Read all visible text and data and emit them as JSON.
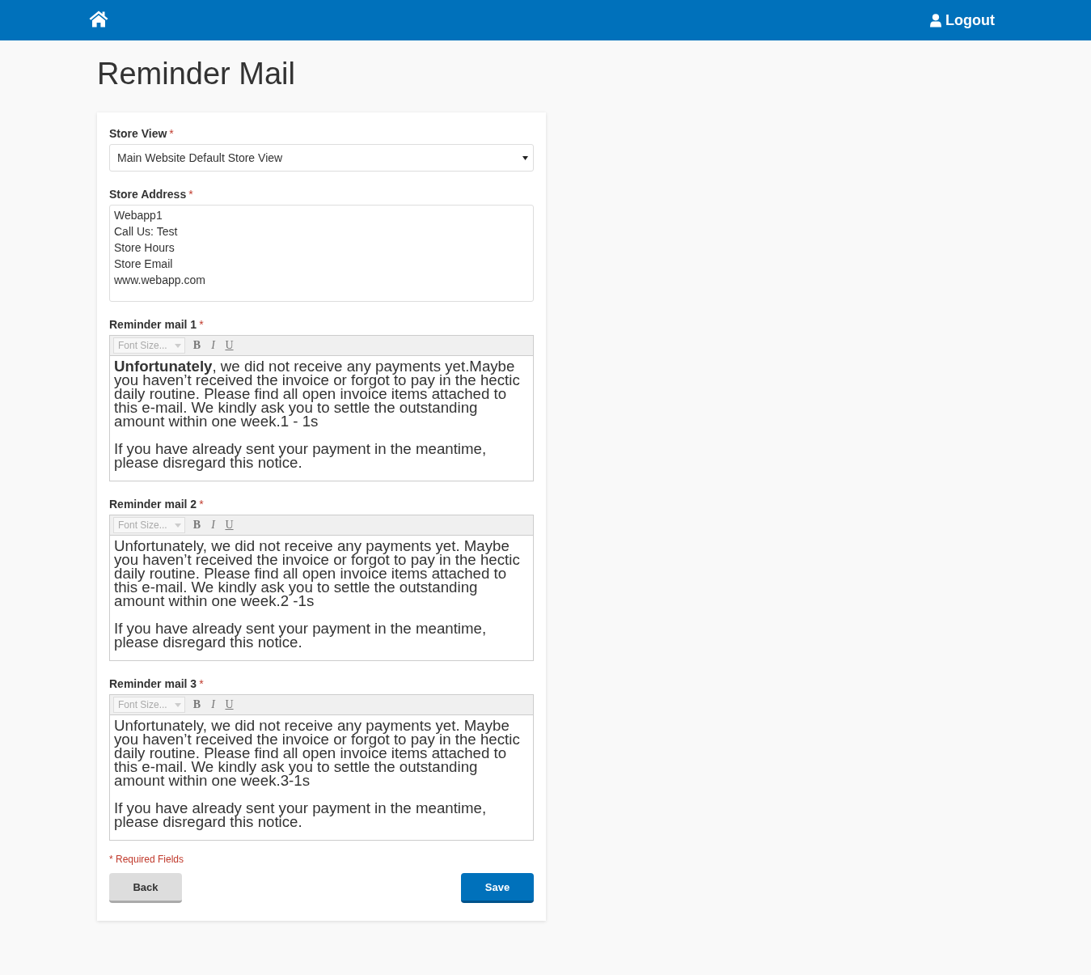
{
  "header": {
    "logout": "Logout"
  },
  "title": "Reminder Mail",
  "form": {
    "fields": [
      {
        "kind": "select",
        "label": "Store View",
        "mark": "*",
        "value": "Main Website Default Store View"
      },
      {
        "kind": "textarea",
        "label": "Store Address",
        "mark": "*",
        "lines": [
          "Webapp1",
          "Call Us: Test",
          "Store Hours",
          "Store Email",
          "www.webapp.com"
        ]
      },
      {
        "kind": "editor",
        "label": "Reminder mail 1",
        "mark": "*",
        "toolbar": {
          "font_size": "Font Size...",
          "bold": "B",
          "italic": "I",
          "underline": "U"
        },
        "paragraphs": [
          "**Unfortunately**, we did not receive any payments yet.Maybe you haven’t received the invoice or forgot to pay in the hectic daily routine. Please find all open invoice items attached to this e-mail. We kindly ask you to settle the outstanding amount within one week.1 - 1s",
          "If you have already sent your payment in the meantime, please disregard this notice."
        ]
      },
      {
        "kind": "editor",
        "label": "Reminder mail 2",
        "mark": "*",
        "toolbar": {
          "font_size": "Font Size...",
          "bold": "B",
          "italic": "I",
          "underline": "U"
        },
        "paragraphs": [
          "Unfortunately, we did not receive any payments yet. Maybe you haven’t received the invoice or forgot to pay in the hectic daily routine. Please find all open invoice items attached to this e-mail. We kindly ask you to settle the outstanding amount within one week.2 -1s",
          "If you have already sent your payment in the meantime, please disregard this notice."
        ]
      },
      {
        "kind": "editor",
        "label": "Reminder mail 3",
        "mark": "*",
        "toolbar": {
          "font_size": "Font Size...",
          "bold": "B",
          "italic": "I",
          "underline": "U"
        },
        "paragraphs": [
          "Unfortunately, we did not receive any payments yet. Maybe you haven’t received the invoice or forgot to pay in the hectic daily routine. Please find all open invoice items attached to this e-mail. We kindly ask you to settle the outstanding amount within one week.3-1s",
          "If you have already sent your payment in the meantime, please disregard this notice."
        ]
      }
    ],
    "required_note": "* Required Fields",
    "buttons": [
      {
        "kind": "back",
        "label": "Back"
      },
      {
        "kind": "save",
        "label": "Save"
      }
    ]
  }
}
